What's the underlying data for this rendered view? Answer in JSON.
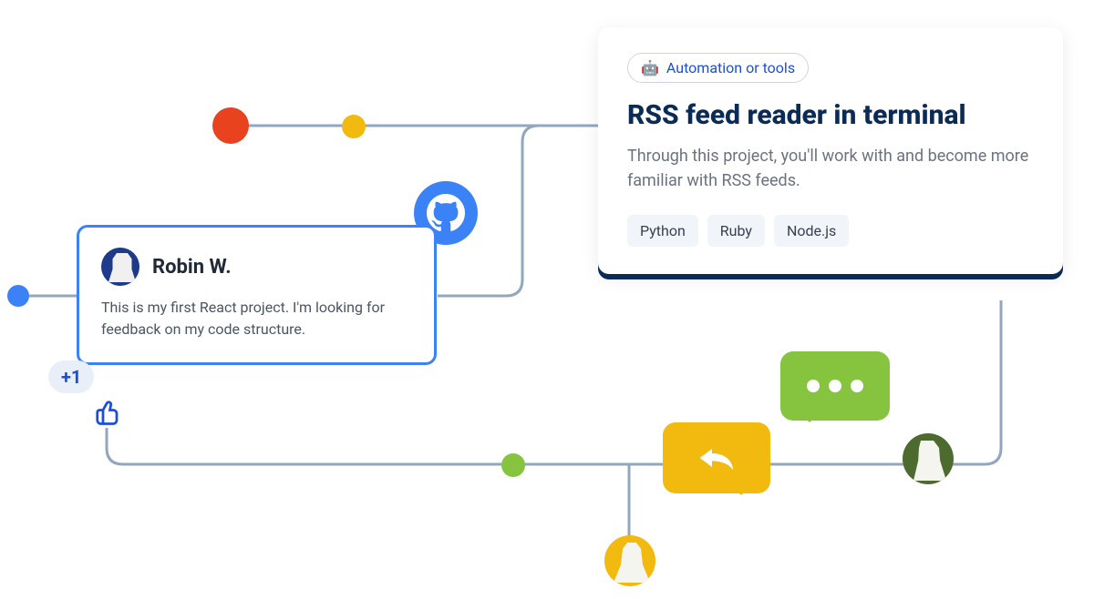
{
  "feedback": {
    "author_name": "Robin W.",
    "message": "This is my first React project. I'm looking for feedback on my code structure.",
    "upvote_label": "+1"
  },
  "project": {
    "category_emoji": "🤖",
    "category_label": "Automation or tools",
    "title": "RSS feed reader in terminal",
    "description": "Through this project, you'll work with and become more familiar with RSS feeds.",
    "tags": [
      "Python",
      "Ruby",
      "Node.js"
    ]
  },
  "colors": {
    "blue": "#3b82f6",
    "orange": "#e8431e",
    "yellow": "#f2b90f",
    "green": "#86c440",
    "navy": "#0b2b57"
  }
}
